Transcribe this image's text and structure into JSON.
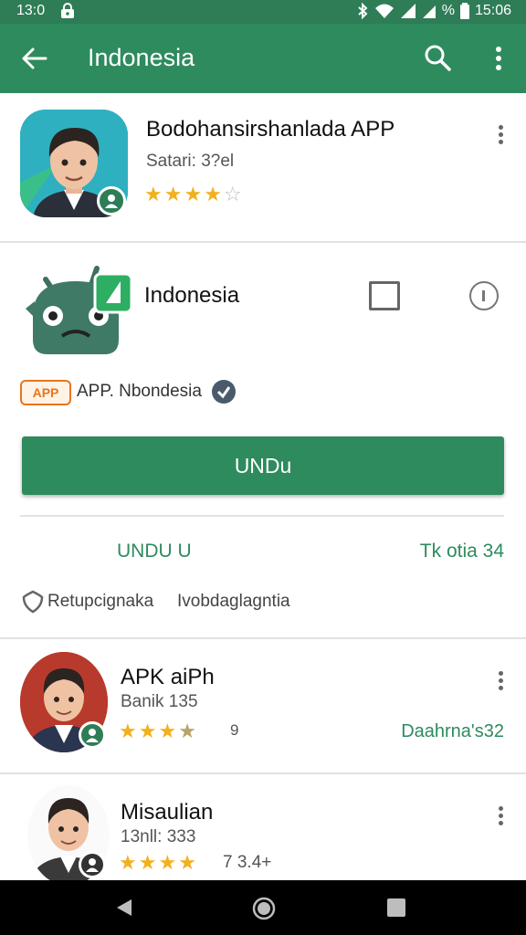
{
  "status_bar": {
    "time_left": "13:0",
    "battery_text": "%",
    "time_right": "15:06"
  },
  "app_bar": {
    "title": "Indonesia"
  },
  "featured": {
    "title": "Bodohansirshanlada APP",
    "subtitle": "Satari: 3?el",
    "rating": 4
  },
  "detail": {
    "app_name": "Indonesia",
    "tag_badge": "APP",
    "tag_text": "APP. Nbondesia",
    "install_label": "UNDu",
    "stat_left": "UNDU U",
    "stat_right": "Tk otia 34",
    "note_left": "Retupcignaka",
    "note_right": "Ivobdaglagntia"
  },
  "list": [
    {
      "title": "APK aiPh",
      "subtitle": "Banik 135",
      "rating": 3.5,
      "rating_text": "9",
      "right_text": "Daahrna's32"
    },
    {
      "title": "Misaulian",
      "subtitle": "13nll: 333",
      "rating": 4.5,
      "rating_text": "7 3.4+",
      "right_text": ""
    }
  ],
  "colors": {
    "primary": "#2e8b5e",
    "status": "#2e7d57",
    "star": "#f2b01e"
  }
}
